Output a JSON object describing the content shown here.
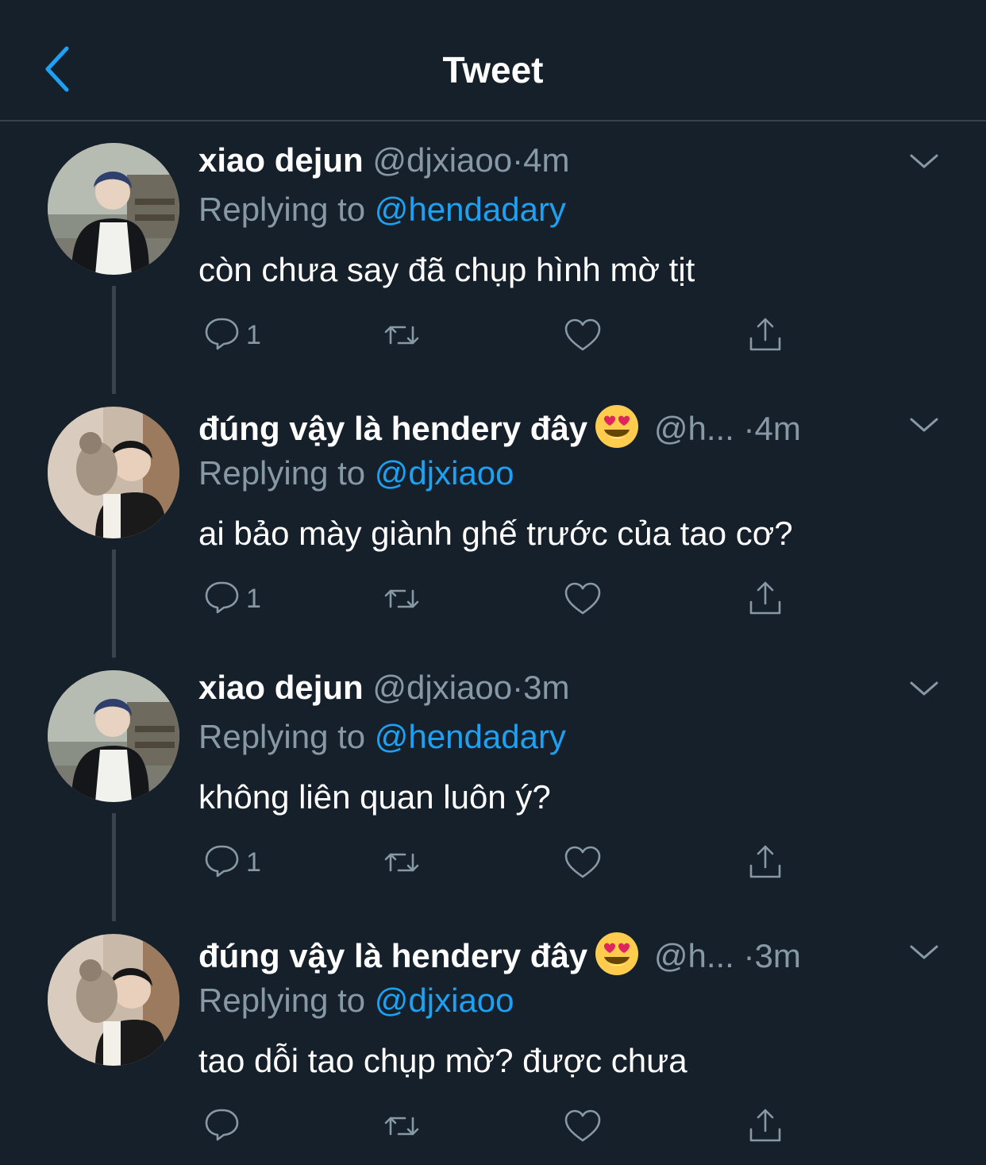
{
  "header": {
    "title": "Tweet",
    "back_icon": "chevron-left-icon"
  },
  "colors": {
    "background": "#15202b",
    "accent": "#1da1f2",
    "muted": "#8899a6",
    "divider": "#38444d"
  },
  "tweets": [
    {
      "name": "xiao dejun",
      "handle": "@djxiaoo",
      "dot": "·",
      "time": "4m",
      "reply_prefix": "Replying to",
      "reply_to": "@hendadary",
      "text": "còn chưa say đã chụp hình mờ tịt",
      "reply_count": "1"
    },
    {
      "name": "đúng vậy là hendery đây",
      "handle": "@h...",
      "dot": "·",
      "time": "4m",
      "reply_prefix": "Replying to",
      "reply_to": "@djxiaoo",
      "text": "ai bảo mày giành ghế trước của tao cơ?",
      "reply_count": "1"
    },
    {
      "name": "xiao dejun",
      "handle": "@djxiaoo",
      "dot": "·",
      "time": "3m",
      "reply_prefix": "Replying to",
      "reply_to": "@hendadary",
      "text": "không liên quan luôn ý?",
      "reply_count": "1"
    },
    {
      "name": "đúng vậy là hendery đây",
      "handle": "@h...",
      "dot": "·",
      "time": "3m",
      "reply_prefix": "Replying to",
      "reply_to": "@djxiaoo",
      "text": "tao dỗi tao chụp mờ? được chưa",
      "reply_count": ""
    }
  ]
}
